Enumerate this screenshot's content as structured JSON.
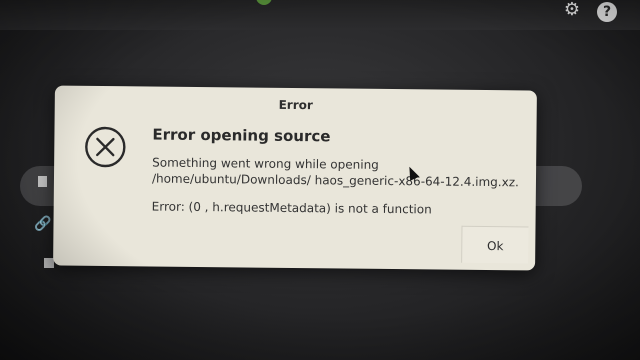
{
  "dialog": {
    "title": "Error",
    "heading": "Error opening source",
    "message": "Something went wrong while opening /home/ubuntu/Downloads/ haos_generic-x86-64-12.4.img.xz.",
    "detail": "Error: (0 , h.requestMetadata) is not a function",
    "ok_label": "Ok"
  },
  "header": {
    "settings_icon": "gear-icon",
    "help_icon": "help-icon",
    "help_glyph": "?"
  }
}
